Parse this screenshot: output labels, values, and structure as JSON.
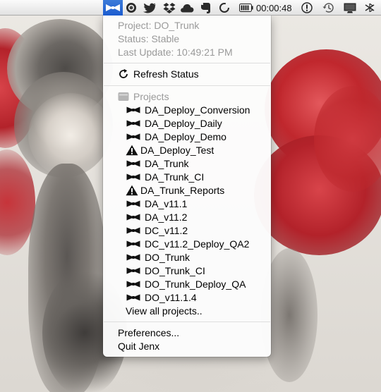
{
  "menubar": {
    "items": [
      {
        "icon": "jenx-bowtie-icon"
      },
      {
        "icon": "record-icon"
      },
      {
        "icon": "twitter-bird-icon"
      },
      {
        "icon": "dropbox-icon"
      },
      {
        "icon": "cloud-icon"
      },
      {
        "icon": "evernote-icon"
      },
      {
        "icon": "spinner-circle-icon"
      },
      {
        "icon": "battery-icon"
      },
      {
        "icon": "alert-icon"
      },
      {
        "icon": "time-machine-icon"
      },
      {
        "icon": "display-icon"
      },
      {
        "icon": "bluetooth-icon"
      }
    ],
    "timer": "00:00:48"
  },
  "menu": {
    "project": "Project: DO_Trunk",
    "status": "Status: Stable",
    "last_update": "Last Update: 10:49:21 PM",
    "refresh": "Refresh Status",
    "projects_header": "Projects",
    "projects": [
      {
        "name": "DA_Deploy_Conversion",
        "state": "ok"
      },
      {
        "name": "DA_Deploy_Daily",
        "state": "ok"
      },
      {
        "name": "DA_Deploy_Demo",
        "state": "ok"
      },
      {
        "name": "DA_Deploy_Test",
        "state": "warning"
      },
      {
        "name": "DA_Trunk",
        "state": "ok"
      },
      {
        "name": "DA_Trunk_CI",
        "state": "ok"
      },
      {
        "name": "DA_Trunk_Reports",
        "state": "warning"
      },
      {
        "name": "DA_v11.1",
        "state": "ok"
      },
      {
        "name": "DA_v11.2",
        "state": "ok"
      },
      {
        "name": "DC_v11.2",
        "state": "ok"
      },
      {
        "name": "DC_v11.2_Deploy_QA2",
        "state": "ok"
      },
      {
        "name": "DO_Trunk",
        "state": "ok"
      },
      {
        "name": "DO_Trunk_CI",
        "state": "ok"
      },
      {
        "name": "DO_Trunk_Deploy_QA",
        "state": "ok"
      },
      {
        "name": "DO_v11.1.4",
        "state": "ok"
      }
    ],
    "view_all": "View all projects..",
    "preferences": "Preferences...",
    "quit": "Quit Jenx"
  },
  "colors": {
    "menubar_active": "#2a6bd6",
    "cloud_red": "#c0272d",
    "smoke_gray": "#6f6b67",
    "menu_bg": "#fcfcfc"
  }
}
